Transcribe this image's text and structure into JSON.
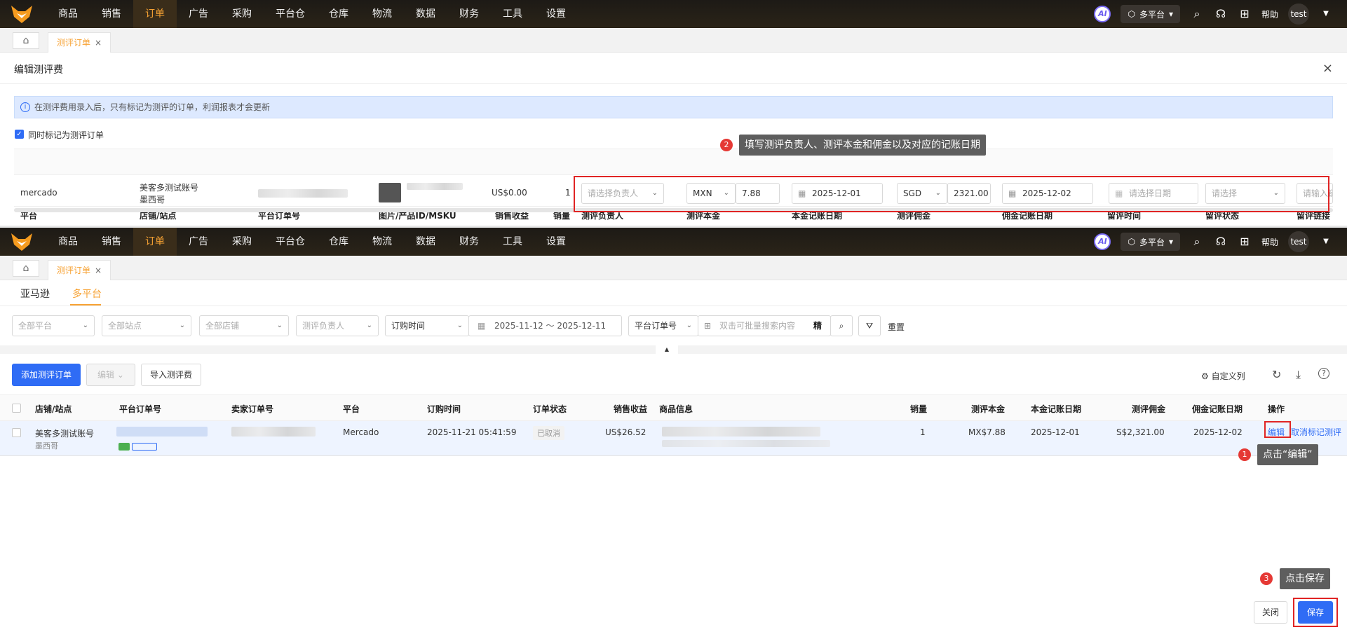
{
  "nav": {
    "items": [
      "商品",
      "销售",
      "订单",
      "广告",
      "采购",
      "平台仓",
      "仓库",
      "物流",
      "数据",
      "财务",
      "工具",
      "设置"
    ],
    "active_index": 2,
    "ai_label": "AI",
    "platform": "多平台",
    "help": "帮助",
    "user": "test"
  },
  "tab": {
    "label": "测评订单",
    "close": "×"
  },
  "modal": {
    "title": "编辑测评费",
    "close": "×",
    "info": "在测评费用录入后，只有标记为测评的订单，利润报表才会更新",
    "checkbox_label": "同时标记为测评订单",
    "headers": [
      "平台",
      "店铺/站点",
      "平台订单号",
      "图片/产品ID/MSKU",
      "销售收益",
      "销量",
      "测评负责人",
      "测评本金",
      "本金记账日期",
      "测评佣金",
      "佣金记账日期",
      "留评时间",
      "留评状态",
      "留评链接"
    ],
    "row": {
      "platform": "mercado",
      "shop": "美客多测试账号",
      "site": "墨西哥",
      "revenue": "US$0.00",
      "qty": "1",
      "owner_placeholder": "请选择负责人",
      "principal_currency": "MXN",
      "principal_amount": "7.88",
      "principal_date": "2025-12-01",
      "commission_currency": "SGD",
      "commission_amount": "2321.00",
      "commission_date": "2025-12-02",
      "review_time_placeholder": "请选择日期",
      "review_status_placeholder": "请选择",
      "review_link_placeholder": "请输入链"
    }
  },
  "callouts": {
    "c1_num": "1",
    "c1_text": "点击“编辑”",
    "c2_num": "2",
    "c2_text": "填写测评负责人、测评本金和佣金以及对应的记账日期",
    "c3_num": "3",
    "c3_text": "点击保存"
  },
  "page": {
    "subtabs": [
      "亚马逊",
      "多平台"
    ],
    "filters": {
      "platform": "全部平台",
      "site": "全部站点",
      "shop": "全部店铺",
      "owner": "测评负责人",
      "time_type": "订购时间",
      "date_range": "2025-11-12 ～ 2025-12-11",
      "search_type": "平台订单号",
      "search_placeholder": "双击可批量搜索内容",
      "exact": "精",
      "reset": "重置"
    },
    "toolbar": {
      "add": "添加测评订单",
      "edit": "编辑",
      "import": "导入测评费",
      "custom_cols": "自定义列"
    },
    "headers": [
      "店铺/站点",
      "平台订单号",
      "卖家订单号",
      "平台",
      "订购时间",
      "订单状态",
      "销售收益",
      "商品信息",
      "销量",
      "测评本金",
      "本金记账日期",
      "测评佣金",
      "佣金记账日期",
      "操作"
    ],
    "row": {
      "shop": "美客多测试账号",
      "site": "墨西哥",
      "platform": "Mercado",
      "order_time": "2025-11-21 05:41:59",
      "status": "已取消",
      "revenue": "US$26.52",
      "qty": "1",
      "principal": "MX$7.88",
      "principal_date": "2025-12-01",
      "commission": "S$2,321.00",
      "commission_date": "2025-12-02",
      "action_edit": "编辑",
      "action_unmark": "取消标记测评"
    },
    "footer": {
      "close": "关闭",
      "save": "保存"
    }
  }
}
